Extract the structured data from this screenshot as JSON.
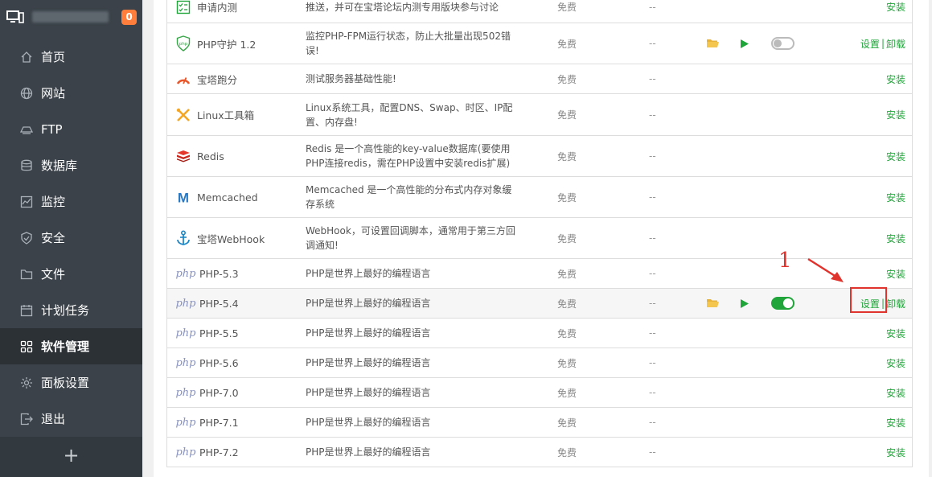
{
  "sidebar": {
    "badge": "0",
    "items": [
      {
        "label": "首页",
        "icon": "home-icon"
      },
      {
        "label": "网站",
        "icon": "globe-icon"
      },
      {
        "label": "FTP",
        "icon": "ftp-icon"
      },
      {
        "label": "数据库",
        "icon": "database-icon"
      },
      {
        "label": "监控",
        "icon": "monitor-chart-icon"
      },
      {
        "label": "安全",
        "icon": "shield-icon"
      },
      {
        "label": "文件",
        "icon": "folder-icon"
      },
      {
        "label": "计划任务",
        "icon": "calendar-icon"
      },
      {
        "label": "软件管理",
        "icon": "grid-icon"
      },
      {
        "label": "面板设置",
        "icon": "gear-icon"
      },
      {
        "label": "退出",
        "icon": "logout-icon"
      }
    ],
    "active": "软件管理",
    "add": "+"
  },
  "table": {
    "rows": [
      {
        "name": "申请内测",
        "logo": "checklist-icon",
        "desc": "推送，并可在宝塔论坛内测专用版块参与讨论",
        "price": "免费",
        "expire": "--",
        "ops": [
          "安装"
        ]
      },
      {
        "name": "PHP守护 1.2",
        "logo": "php-shield-icon",
        "desc": "监控PHP-FPM运行状态，防止大批量出现502错误!",
        "price": "免费",
        "expire": "--",
        "ops": [
          "设置",
          "卸载"
        ],
        "controls": true,
        "enabled": false
      },
      {
        "name": "宝塔跑分",
        "logo": "gauge-icon",
        "desc": "测试服务器基础性能!",
        "price": "免费",
        "expire": "--",
        "ops": [
          "安装"
        ]
      },
      {
        "name": "Linux工具箱",
        "logo": "tools-icon",
        "desc": "Linux系统工具，配置DNS、Swap、时区、IP配置、内存盘!",
        "price": "免费",
        "expire": "--",
        "ops": [
          "安装"
        ]
      },
      {
        "name": "Redis",
        "logo": "redis-icon",
        "desc": "Redis 是一个高性能的key-value数据库(要使用PHP连接redis，需在PHP设置中安装redis扩展)",
        "price": "免费",
        "expire": "--",
        "ops": [
          "安装"
        ]
      },
      {
        "name": "Memcached",
        "logo": "memcached-icon",
        "desc": "Memcached 是一个高性能的分布式内存对象缓存系统",
        "price": "免费",
        "expire": "--",
        "ops": [
          "安装"
        ]
      },
      {
        "name": "宝塔WebHook",
        "logo": "anchor-icon",
        "desc": "WebHook，可设置回调脚本，通常用于第三方回调通知!",
        "price": "免费",
        "expire": "--",
        "ops": [
          "安装"
        ]
      },
      {
        "name": "PHP-5.3",
        "logo": "php-logo",
        "desc": "PHP是世界上最好的编程语言",
        "price": "免费",
        "expire": "--",
        "ops": [
          "安装"
        ]
      },
      {
        "name": "PHP-5.4",
        "logo": "php-logo",
        "desc": "PHP是世界上最好的编程语言",
        "price": "免费",
        "expire": "--",
        "ops": [
          "设置",
          "卸载"
        ],
        "controls": true,
        "enabled": true
      },
      {
        "name": "PHP-5.5",
        "logo": "php-logo",
        "desc": "PHP是世界上最好的编程语言",
        "price": "免费",
        "expire": "--",
        "ops": [
          "安装"
        ]
      },
      {
        "name": "PHP-5.6",
        "logo": "php-logo",
        "desc": "PHP是世界上最好的编程语言",
        "price": "免费",
        "expire": "--",
        "ops": [
          "安装"
        ]
      },
      {
        "name": "PHP-7.0",
        "logo": "php-logo",
        "desc": "PHP是世界上最好的编程语言",
        "price": "免费",
        "expire": "--",
        "ops": [
          "安装"
        ]
      },
      {
        "name": "PHP-7.1",
        "logo": "php-logo",
        "desc": "PHP是世界上最好的编程语言",
        "price": "免费",
        "expire": "--",
        "ops": [
          "安装"
        ]
      },
      {
        "name": "PHP-7.2",
        "logo": "php-logo",
        "desc": "PHP是世界上最好的编程语言",
        "price": "免费",
        "expire": "--",
        "ops": [
          "安装"
        ]
      }
    ],
    "php_logo_text": "php"
  },
  "annotation": {
    "number": "1"
  },
  "colors": {
    "accent": "#20a53a",
    "sidebar": "#3b4249",
    "badge": "#ff7e3b",
    "annotation": "#e0332e"
  }
}
